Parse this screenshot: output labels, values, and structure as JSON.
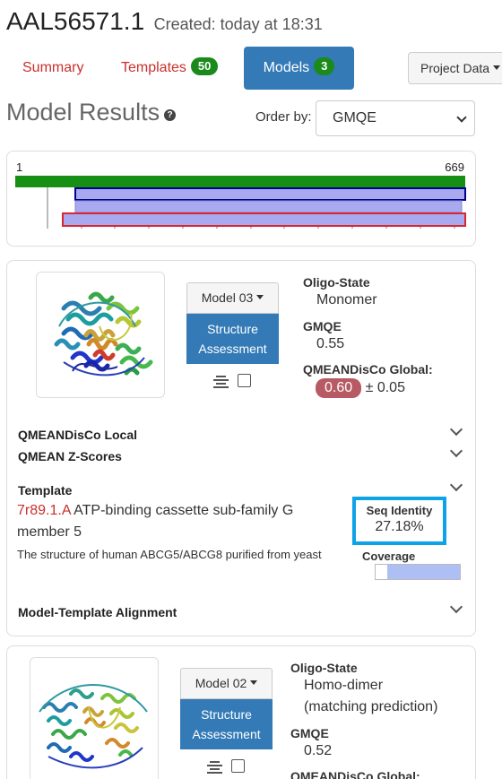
{
  "header": {
    "accession": "AAL56571.1",
    "created": "Created: today at 18:31"
  },
  "tabs": [
    {
      "label": "Summary"
    },
    {
      "label": "Templates",
      "badge": "50"
    },
    {
      "label": "Models",
      "badge": "3",
      "active": true
    }
  ],
  "project_data_label": "Project Data",
  "results_title": "Model Results",
  "order": {
    "label": "Order by:",
    "selected": "GMQE"
  },
  "coverage_overview": {
    "start": "1",
    "end": "669",
    "colors": {
      "target": "#159015",
      "model1": "#00008b",
      "model3": "#d9262c",
      "fill": "#a9a9f0"
    }
  },
  "models": [
    {
      "dropdown_label": "Model 03",
      "assessment_label": [
        "Structure",
        "Assessment"
      ],
      "oligo_state_label": "Oligo-State",
      "oligo_state": [
        "Monomer"
      ],
      "gmqe_label": "GMQE",
      "gmqe": "0.55",
      "qmean_label": "QMEANDisCo Global:",
      "qmean": "0.60",
      "qmean_err": "± 0.05",
      "sections": [
        "QMEANDisCo Local",
        "QMEAN Z-Scores"
      ],
      "template_label": "Template",
      "template_id": "7r89.1.A",
      "template_desc": "ATP-binding cassette sub-family G member 5",
      "template_note": "The structure of human ABCG5/ABCG8 purified from yeast",
      "seq_identity_label": "Seq Identity",
      "seq_identity": "27.18%",
      "coverage_label": "Coverage",
      "coverage_fraction": 0.86,
      "alignment_label": "Model-Template Alignment"
    },
    {
      "dropdown_label": "Model 02",
      "assessment_label": [
        "Structure",
        "Assessment"
      ],
      "oligo_state_label": "Oligo-State",
      "oligo_state": [
        "Homo-dimer",
        "(matching prediction)"
      ],
      "gmqe_label": "GMQE",
      "gmqe": "0.52",
      "qmean_label": "QMEANDisCo Global:"
    }
  ]
}
